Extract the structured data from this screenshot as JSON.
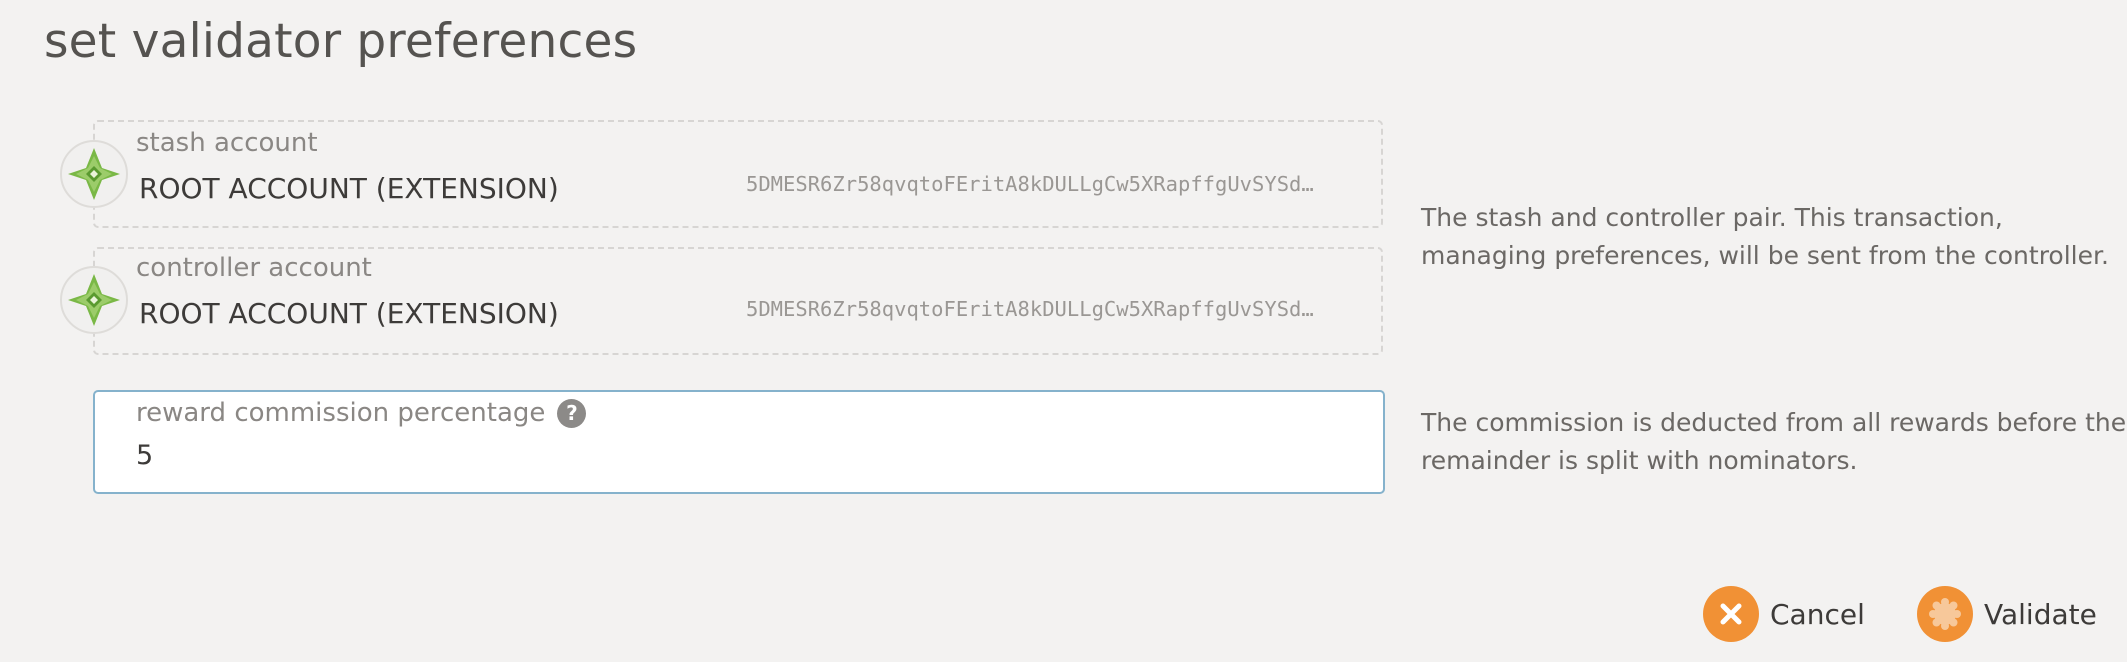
{
  "modal": {
    "title": "set validator preferences"
  },
  "stash": {
    "label": "stash account",
    "name": "ROOT ACCOUNT (EXTENSION)",
    "address": "5DMESR6Zr58qvqtoFEritA8kDULLgCw5XRapffgUvSYSd…"
  },
  "controller": {
    "label": "controller account",
    "name": "ROOT ACCOUNT (EXTENSION)",
    "address": "5DMESR6Zr58qvqtoFEritA8kDULLgCw5XRapffgUvSYSd…"
  },
  "help": {
    "accounts_line1": "The stash and controller pair. This transaction,",
    "accounts_line2": "managing preferences, will be sent from the controller.",
    "commission_line1": "The commission is deducted from all rewards before the",
    "commission_line2": "remainder is split with nominators."
  },
  "commission": {
    "label": "reward commission percentage",
    "help_icon": "?",
    "value": "5"
  },
  "actions": {
    "cancel_label": "Cancel",
    "validate_label": "Validate"
  },
  "icons": {
    "identicon": "polkadot-identicon",
    "cancel": "close-icon",
    "validate": "certificate-icon",
    "help": "question-circle-icon"
  },
  "colors": {
    "background": "#f3f2f1",
    "accent": "#f19135",
    "focus_border": "#85b2cc",
    "identicon_green": "#7ab846"
  }
}
